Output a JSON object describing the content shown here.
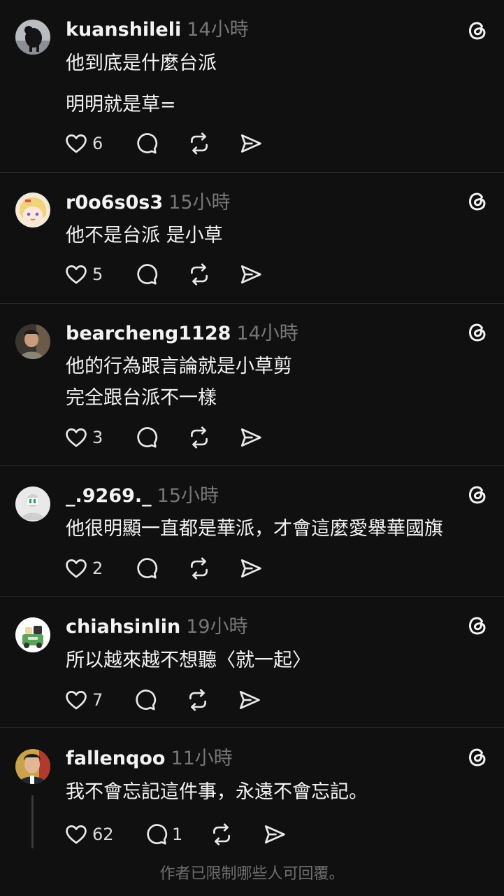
{
  "colors": {
    "background": "#101010",
    "text": "#f3f3f3",
    "muted": "#777777",
    "divider": "#2a2a2a"
  },
  "posts": [
    {
      "username": "kuanshileli",
      "time": "14小時",
      "lines": [
        "他到底是什麼台派",
        "明明就是草="
      ],
      "likes": "6",
      "replies": ""
    },
    {
      "username": "r0o6s0s3",
      "time": "15小時",
      "lines": [
        "他不是台派 是小草"
      ],
      "likes": "5",
      "replies": ""
    },
    {
      "username": "bearcheng1128",
      "time": "14小時",
      "lines": [
        "他的行為跟言論就是小草剪",
        "完全跟台派不一樣"
      ],
      "likes": "3",
      "replies": ""
    },
    {
      "username": "_.9269._",
      "time": "15小時",
      "lines": [
        "他很明顯一直都是華派，才會這麼愛舉華國旗"
      ],
      "likes": "2",
      "replies": ""
    },
    {
      "username": "chiahsinlin",
      "time": "19小時",
      "lines": [
        "所以越來越不想聽〈就一起〉"
      ],
      "likes": "7",
      "replies": ""
    },
    {
      "username": "fallenqoo",
      "time": "11小時",
      "lines": [
        "我不會忘記這件事，永遠不會忘記。"
      ],
      "likes": "62",
      "replies": "1"
    }
  ],
  "footer": "作者已限制哪些人可回覆。"
}
